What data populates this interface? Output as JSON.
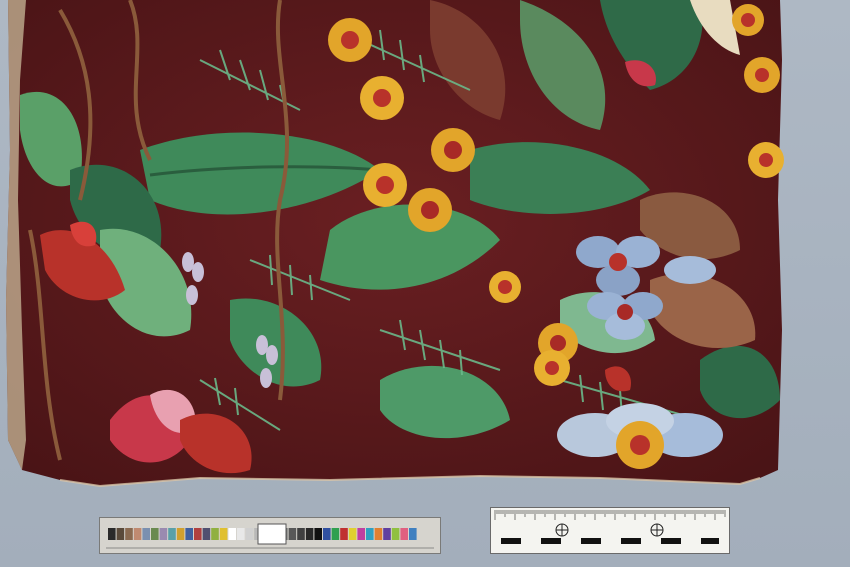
{
  "scene": {
    "subject": "textile",
    "palette": {
      "ground": "#5e1a1c",
      "leaf_dark": "#2f6a48",
      "leaf_mid": "#4f9a6a",
      "leaf_light": "#8fc89a",
      "flower_yellow": "#e2a52a",
      "flower_red": "#b8322a",
      "flower_blue": "#8fa8cc",
      "backdrop": "#a9b4c0"
    }
  },
  "color_card": {
    "swatches": [
      "#2a2a2a",
      "#5a4a3a",
      "#8a6a50",
      "#c08a70",
      "#7a90b0",
      "#6a8a50",
      "#9a8ab0",
      "#5aa0a8",
      "#d0a030",
      "#4060a0",
      "#b04040",
      "#505070",
      "#90b040",
      "#e0c030",
      "#ffffff",
      "#e8e8e8",
      "#d0d0d0",
      "#b8b8b8",
      "#a0a0a0",
      "#888888",
      "#707070",
      "#585858",
      "#404040",
      "#282828",
      "#101010",
      "#3050a0",
      "#30a050",
      "#c03030",
      "#e0d030",
      "#c040a0",
      "#30a0c0",
      "#e08030",
      "#6040a0",
      "#90c040",
      "#e06080",
      "#4080c0"
    ]
  },
  "scale_bar": {}
}
